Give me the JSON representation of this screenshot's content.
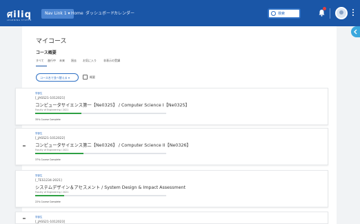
{
  "header": {
    "logo": "ศiliq",
    "logo_sub": "LEARNING SYSTEM",
    "nav": [
      {
        "label": "Nav Link 1 ▾"
      },
      {
        "label": "Home"
      },
      {
        "label": "ダッシュボード"
      },
      {
        "label": "カレンダー"
      }
    ],
    "search_label": "検索",
    "colors": {
      "bar": "#1a56a7",
      "active": "#4d86d2",
      "badge": "#e04040"
    },
    "icons": [
      "search-icon",
      "bell-icon",
      "avatar-icon",
      "kebab-icon"
    ]
  },
  "page": {
    "title": "マイコース",
    "section_title": "コース概要",
    "filter_tabs": [
      "すべて",
      "進行中",
      "未来",
      "過去",
      "お気に入り",
      "非表示の受講"
    ],
    "sort_label": "コース名で並べ替える ▾",
    "view_label": "概要"
  },
  "courses": [
    {
      "tag": "学部生",
      "code": "[_JASS21-1012021]",
      "title": "コンピュータサイエンス第一【Ne0325】 / Computer Science I【Ne0325】",
      "sub": "Faculty of Engineering / 2021",
      "progress_percent": 35,
      "progress_text": "35% Course Complete"
    },
    {
      "tag": "学部生",
      "code": "[_JASS21-1012022]",
      "title": "コンピュータサイエンス第二【Ne0326】 / Computer Science II【Ne0326】",
      "sub": "Faculty of Engineering / 2021",
      "progress_percent": 37,
      "progress_text": "37% Course Complete"
    },
    {
      "tag": "学部生",
      "code": "[_TES1234-2021]",
      "title": "システムデザイン＆アセスメント / System Design & Impact Assessment",
      "sub": "Faculty of Engineering / 2021",
      "progress_percent": 22,
      "progress_text": "22% Course Complete"
    },
    {
      "tag": "学部生",
      "code": "[_JASS21-1012023]",
      "title": "",
      "sub": "",
      "progress_percent": 0,
      "progress_text": ""
    }
  ]
}
